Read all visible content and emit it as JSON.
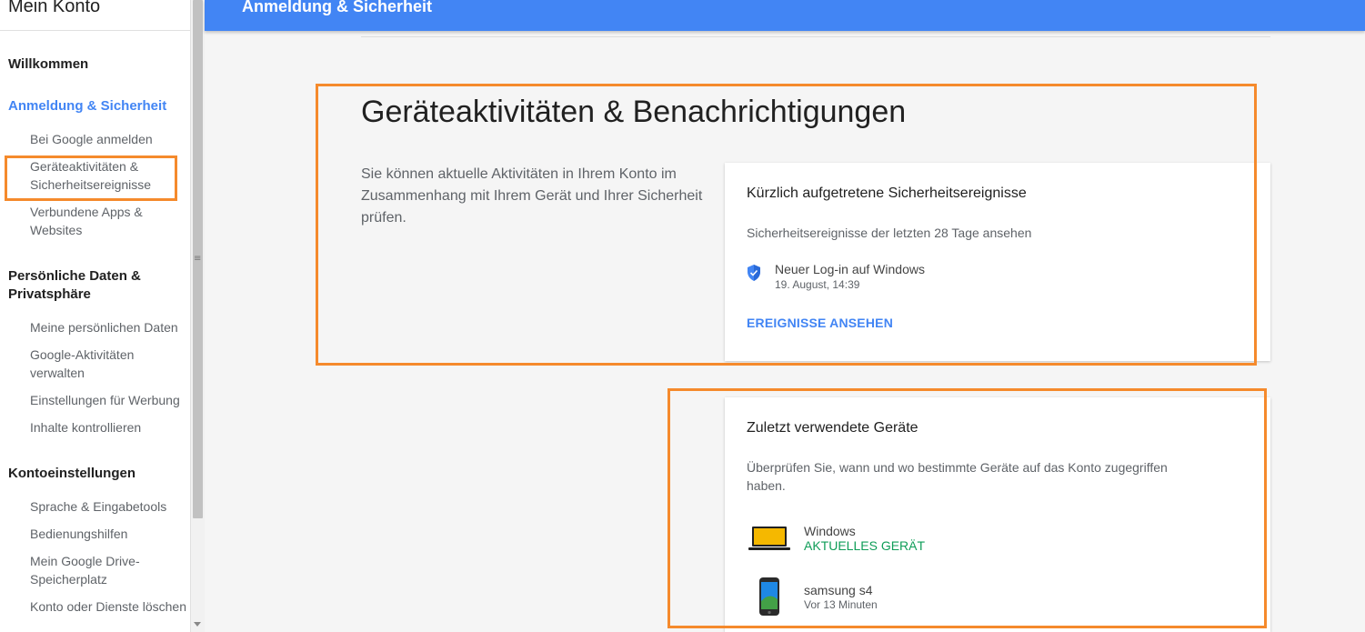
{
  "sidebar": {
    "app_title": "Mein Konto",
    "welcome": "Willkommen",
    "sections": [
      {
        "title": "Anmeldung & Sicherheit",
        "items": [
          "Bei Google anmelden",
          "Geräteaktivitäten & Sicherheitsereignisse",
          "Verbundene Apps & Websites"
        ]
      },
      {
        "title": "Persönliche Daten & Privatsphäre",
        "items": [
          "Meine persönlichen Daten",
          "Google-Aktivitäten verwalten",
          "Einstellungen für Werbung",
          "Inhalte kontrollieren"
        ]
      },
      {
        "title": "Kontoeinstellungen",
        "items": [
          "Sprache & Eingabetools",
          "Bedienungshilfen",
          "Mein Google Drive-Speicherplatz",
          "Konto oder Dienste löschen"
        ]
      }
    ]
  },
  "header": {
    "title": "Anmeldung & Sicherheit"
  },
  "main": {
    "heading": "Geräteaktivitäten & Benachrichtigungen",
    "intro": "Sie können aktuelle Aktivitäten in Ihrem Konto im Zusammenhang mit Ihrem Gerät und Ihrer Sicherheit prüfen."
  },
  "security_card": {
    "title": "Kürzlich aufgetretene Sicherheitsereignisse",
    "description": "Sicherheitsereignisse der letzten 28 Tage ansehen",
    "event": {
      "title": "Neuer Log-in auf Windows",
      "time": "19. August, 14:39",
      "icon": "shield-icon"
    },
    "link": "EREIGNISSE ANSEHEN"
  },
  "devices_card": {
    "title": "Zuletzt verwendete Geräte",
    "description": "Überprüfen Sie, wann und wo bestimmte Geräte auf das Konto zugegriffen haben.",
    "devices": [
      {
        "name": "Windows",
        "status": "AKTUELLES GERÄT",
        "icon": "laptop-icon"
      },
      {
        "name": "samsung s4",
        "status": "Vor 13 Minuten",
        "icon": "phone-icon"
      }
    ]
  },
  "colors": {
    "accent": "#4285f4",
    "annotation": "#f58a2c",
    "current_device": "#0f9d58"
  }
}
